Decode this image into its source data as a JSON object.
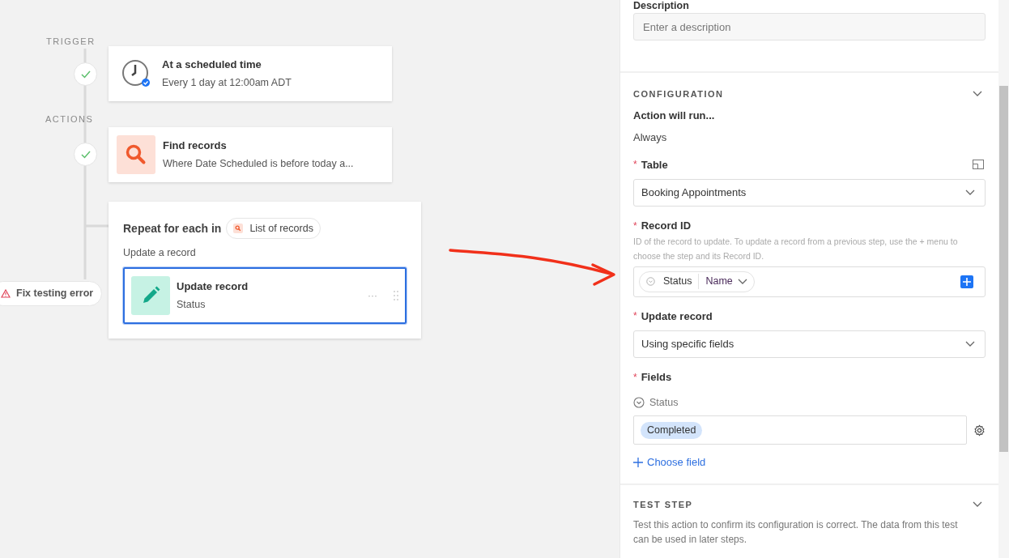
{
  "canvas": {
    "trigger_label": "TRIGGER",
    "actions_label": "ACTIONS",
    "trigger": {
      "title": "At a scheduled time",
      "subtitle": "Every 1 day at 12:00am ADT",
      "complete": true
    },
    "find_step": {
      "title": "Find records",
      "subtitle": "Where Date Scheduled is before today a...",
      "complete": true
    },
    "loop": {
      "heading": "Repeat for each in",
      "source": "List of records",
      "caption": "Update a record",
      "step": {
        "title": "Update record",
        "subtitle": "Status",
        "selected": true,
        "menu": "···"
      }
    },
    "error_badge": "Fix testing error"
  },
  "panel": {
    "description": {
      "label": "Description",
      "placeholder": "Enter a description"
    },
    "configuration": {
      "title": "CONFIGURATION",
      "run_label": "Action will run...",
      "run_value": "Always",
      "table": {
        "label": "Table",
        "required": "*",
        "value": "Booking Appointments"
      },
      "record_id": {
        "label": "Record ID",
        "required": "*",
        "help": "ID of the record to update. To update a record from a previous step, use the + menu to choose the step and its Record ID.",
        "token_field": "Status",
        "token_value": "Name"
      },
      "update_record": {
        "label": "Update record",
        "required": "*",
        "value": "Using specific fields"
      },
      "fields": {
        "label": "Fields",
        "required": "*",
        "items": [
          {
            "name": "Status",
            "value": "Completed"
          }
        ],
        "add": "Choose field"
      }
    },
    "test_step": {
      "title": "TEST STEP",
      "text": "Test this action to confirm its configuration is correct. The data from this test can be used in later steps."
    }
  }
}
